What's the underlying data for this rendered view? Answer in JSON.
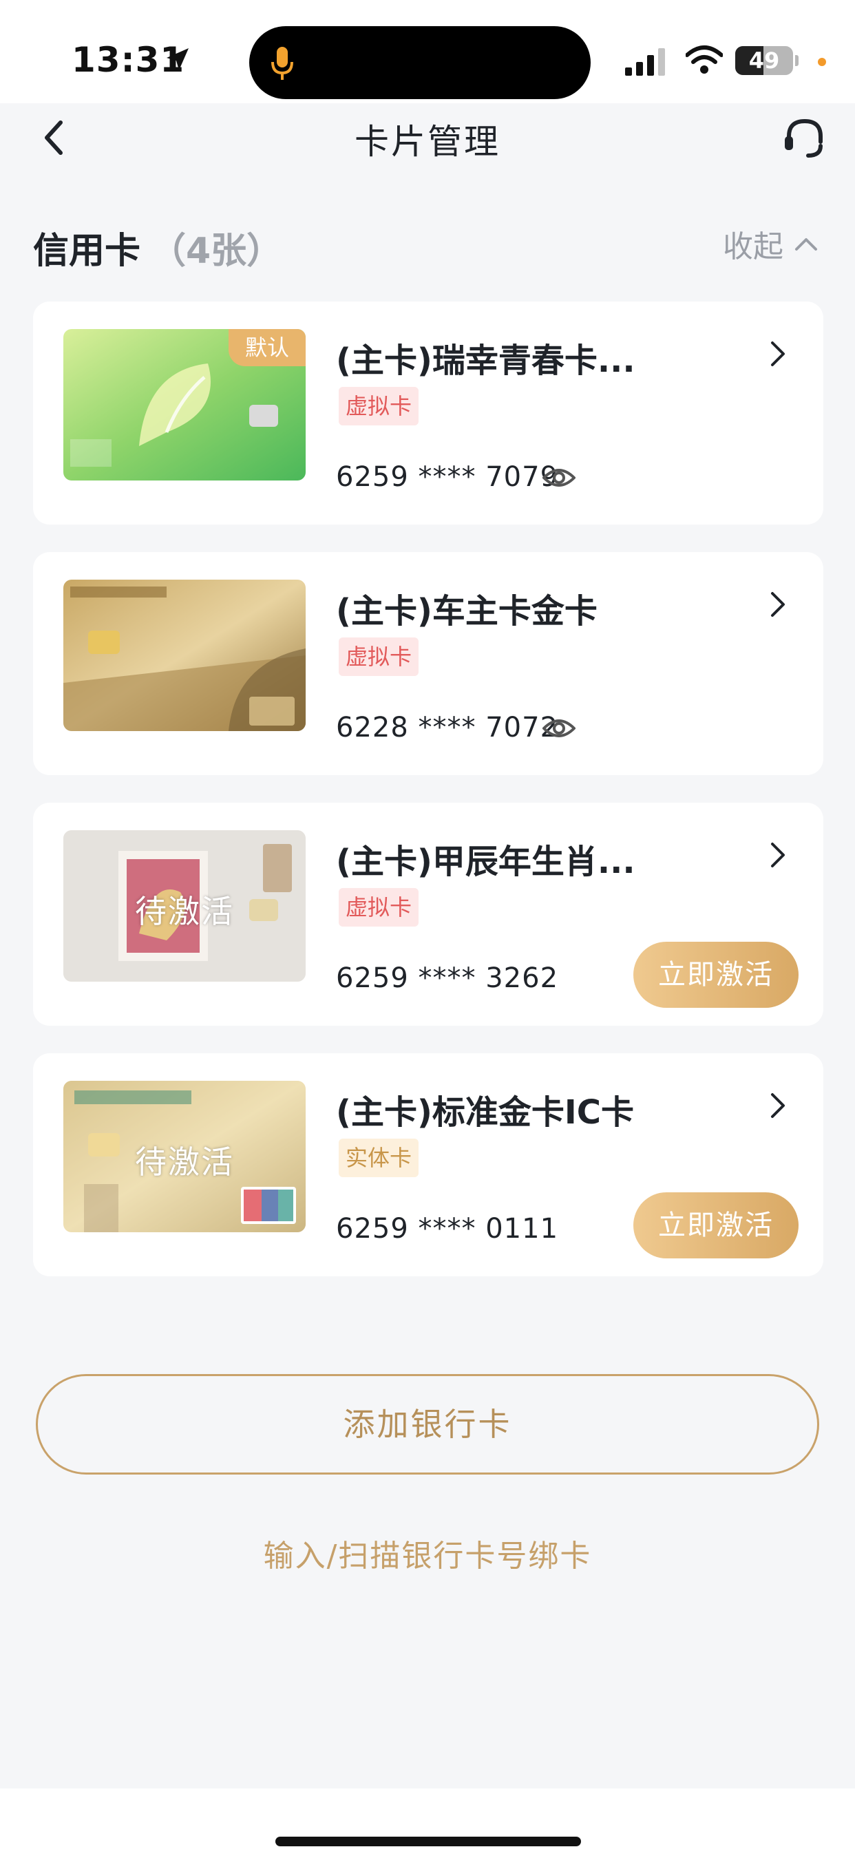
{
  "status_bar": {
    "time": "13:31",
    "battery": "49",
    "battery_level": 0.49,
    "icons": [
      "location-arrow-icon",
      "microphone-icon",
      "cellular-signal-icon",
      "wifi-icon",
      "battery-icon"
    ]
  },
  "header": {
    "title": "卡片管理",
    "back_icon": "chevron-left-icon",
    "support_icon": "headset-icon"
  },
  "section": {
    "title": "信用卡",
    "count": "（4张）",
    "collapse_label": "收起"
  },
  "cards": [
    {
      "name": "(主卡)瑞幸青春卡...",
      "tag": "虚拟卡",
      "number": "6259 **** 7079",
      "default_badge": "默认",
      "show_eye": true,
      "card_art": "green"
    },
    {
      "name": "(主卡)车主卡金卡",
      "tag": "虚拟卡",
      "number": "6228 **** 7072",
      "show_eye": true,
      "card_art": "gold-car"
    },
    {
      "name": "(主卡)甲辰年生肖...",
      "tag": "虚拟卡",
      "number": "6259 **** 3262",
      "pending_label": "待激活",
      "activate_label": "立即激活",
      "card_art": "zodiac"
    },
    {
      "name": "(主卡)标准金卡IC卡",
      "tag": "实体卡",
      "number": "6259 **** 0111",
      "pending_label": "待激活",
      "activate_label": "立即激活",
      "card_art": "gold-standard"
    }
  ],
  "actions": {
    "add_card": "添加银行卡",
    "bind_link": "输入/扫描银行卡号绑卡"
  },
  "colors": {
    "accent_gold": "#d9a965",
    "virtual_tag": "#e25a5a",
    "physical_tag": "#c8964a",
    "page_bg": "#f5f6f8"
  }
}
